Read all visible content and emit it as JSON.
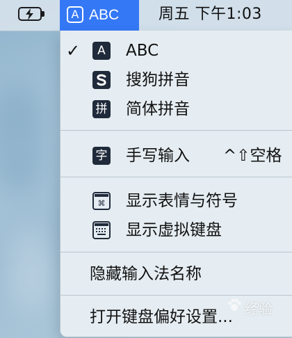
{
  "menubar": {
    "battery_icon": "battery-charging-icon",
    "input_source": {
      "icon_letter": "A",
      "label": "ABC",
      "accent": "#3478f6"
    },
    "clock": "周五 下午1:03"
  },
  "menu": {
    "input_methods": [
      {
        "label": "ABC",
        "icon": "A",
        "checked": true,
        "icon_name": "abc-input-icon"
      },
      {
        "label": "搜狗拼音",
        "icon": "S",
        "checked": false,
        "icon_name": "sogou-input-icon"
      },
      {
        "label": "简体拼音",
        "icon": "拼",
        "checked": false,
        "icon_name": "pinyin-input-icon"
      }
    ],
    "handwriting": {
      "label": "手写输入",
      "icon": "字",
      "shortcut": "^⇧空格"
    },
    "viewers": [
      {
        "label": "显示表情与符号",
        "icon_name": "emoji-symbols-icon"
      },
      {
        "label": "显示虚拟键盘",
        "icon_name": "keyboard-viewer-icon"
      }
    ],
    "hide_names": "隐藏输入法名称",
    "open_prefs": "打开键盘偏好设置..."
  },
  "watermark": "经验"
}
